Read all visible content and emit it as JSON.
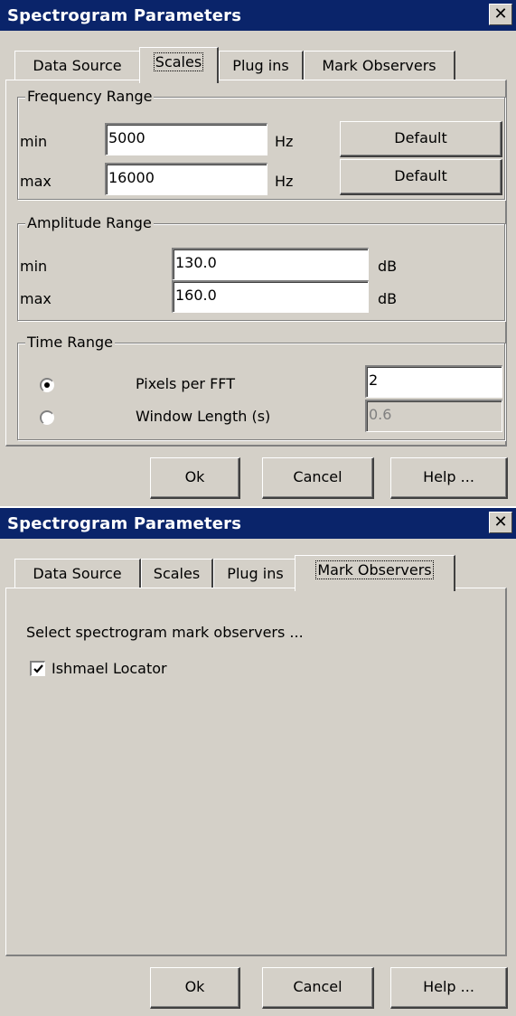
{
  "dialog_title": "Spectrogram Parameters",
  "close_glyph": "✕",
  "tabs": [
    {
      "label": "Data Source"
    },
    {
      "label": "Scales"
    },
    {
      "label": "Plug ins"
    },
    {
      "label": "Mark Observers"
    }
  ],
  "scales": {
    "frequency": {
      "legend": "Frequency Range",
      "min_label": "min",
      "max_label": "max",
      "min_value": "5000",
      "max_value": "16000",
      "unit": "Hz",
      "default_label": "Default"
    },
    "amplitude": {
      "legend": "Amplitude Range",
      "min_label": "min",
      "max_label": "max",
      "min_value": "130.0",
      "max_value": "160.0",
      "unit": "dB"
    },
    "time": {
      "legend": "Time Range",
      "pixels_label": "Pixels per FFT",
      "pixels_value": "2",
      "pixels_selected": true,
      "window_label": "Window Length (s)",
      "window_value": "0.6",
      "window_selected": false
    }
  },
  "mark_observers": {
    "prompt": "Select spectrogram mark observers ...",
    "items": [
      {
        "label": "Ishmael Locator",
        "checked": true
      }
    ]
  },
  "buttons": {
    "ok": "Ok",
    "cancel": "Cancel",
    "help": "Help ..."
  },
  "active_tab_dialog1": "Scales",
  "active_tab_dialog2": "Mark Observers",
  "colors": {
    "titlebar": "#0a246a",
    "face": "#d4d0c8",
    "field": "#ffffff"
  }
}
